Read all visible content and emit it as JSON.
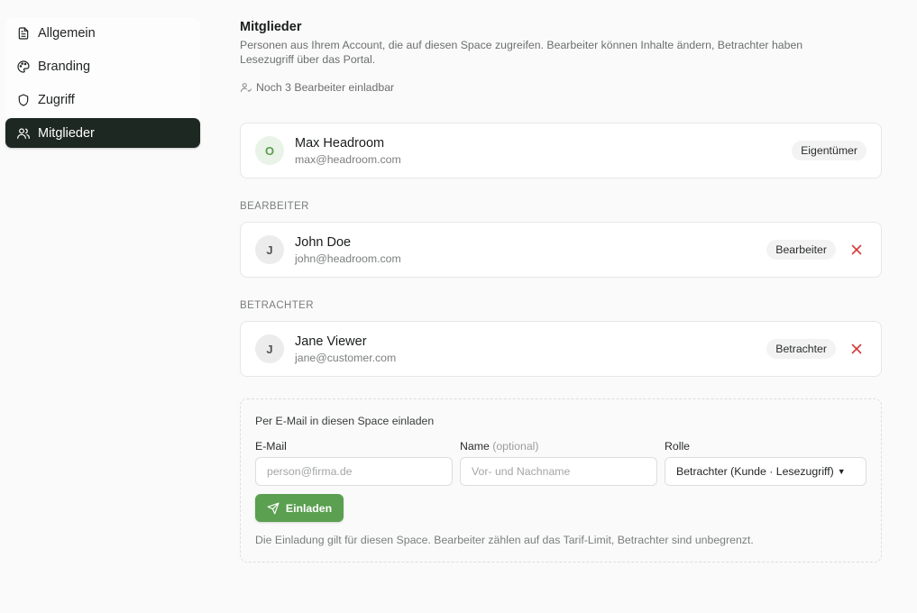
{
  "sidebar": {
    "items": [
      {
        "label": "Allgemein",
        "icon": "document-icon",
        "active": false
      },
      {
        "label": "Branding",
        "icon": "palette-icon",
        "active": false
      },
      {
        "label": "Zugriff",
        "icon": "shield-icon",
        "active": false
      },
      {
        "label": "Mitglieder",
        "icon": "users-icon",
        "active": true
      }
    ]
  },
  "main": {
    "title": "Mitglieder",
    "description": "Personen aus Ihrem Account, die auf diesen Space zugreifen. Bearbeiter können Inhalte ändern, Betrachter haben Lesezugriff über das Portal.",
    "quota": "Noch 3 Bearbeiter einladbar",
    "owner": {
      "initial": "O",
      "name": "Max Headroom",
      "email": "max@headroom.com",
      "role": "Eigentümer"
    },
    "editors_label": "BEARBEITER",
    "editors": [
      {
        "initial": "J",
        "name": "John Doe",
        "email": "john@headroom.com",
        "role": "Bearbeiter"
      }
    ],
    "viewers_label": "BETRACHTER",
    "viewers": [
      {
        "initial": "J",
        "name": "Jane Viewer",
        "email": "jane@customer.com",
        "role": "Betrachter"
      }
    ]
  },
  "invite": {
    "title": "Per E-Mail in diesen Space einladen",
    "email_label": "E-Mail",
    "email_placeholder": "person@firma.de",
    "name_label": "Name",
    "name_optional": "(optional)",
    "name_placeholder": "Vor- und Nachname",
    "role_label": "Rolle",
    "role_value": "Betrachter (Kunde · Lesezugriff)",
    "submit_label": "Einladen",
    "hint": "Die Einladung gilt für diesen Space. Bearbeiter zählen auf das Tarif-Limit, Betrachter sind unbegrenzt."
  },
  "colors": {
    "active_nav": "#1e2823",
    "primary_button": "#5aa050",
    "remove": "#d33b3b"
  }
}
